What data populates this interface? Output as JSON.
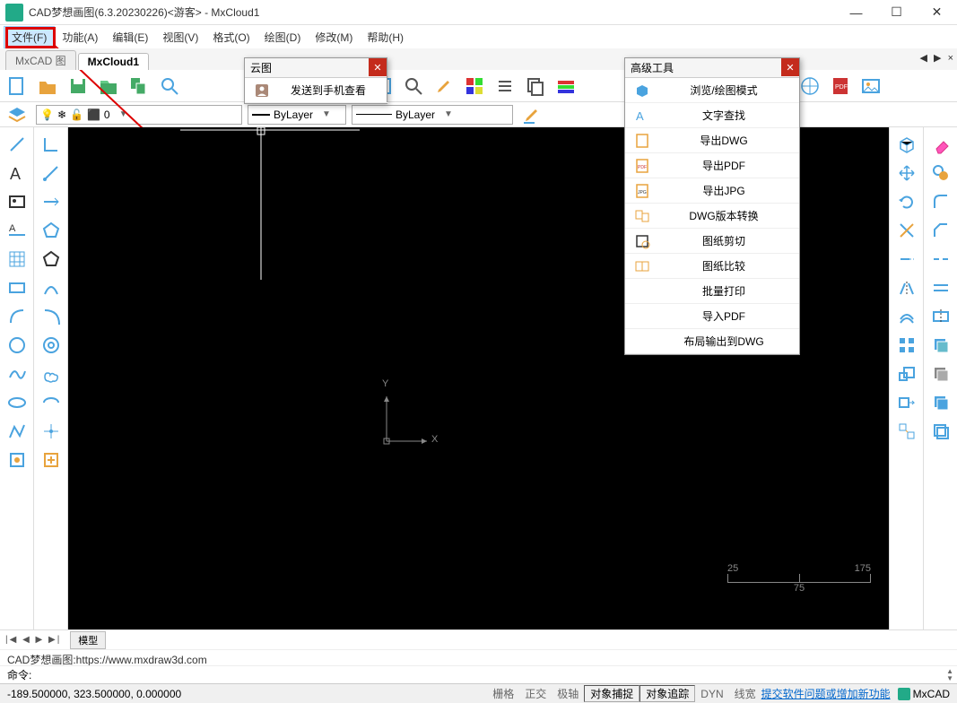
{
  "title": "CAD梦想画图(6.3.20230226)<游客> - MxCloud1",
  "menu": {
    "file": "文件(F)",
    "func": "功能(A)",
    "edit": "编辑(E)",
    "view": "视图(V)",
    "format": "格式(O)",
    "draw": "绘图(D)",
    "modify": "修改(M)",
    "help": "帮助(H)"
  },
  "tabs": {
    "t1": "MxCAD 图",
    "t2": "MxCloud1"
  },
  "cloudMenu": {
    "title": "云图",
    "item1": "发送到手机查看"
  },
  "advMenu": {
    "title": "高级工具",
    "i1": "浏览/绘图模式",
    "i2": "文字查找",
    "i3": "导出DWG",
    "i4": "导出PDF",
    "i5": "导出JPG",
    "i6": "DWG版本转换",
    "i7": "图纸剪切",
    "i8": "图纸比较",
    "i9": "批量打印",
    "i10": "导入PDF",
    "i11": "布局输出到DWG"
  },
  "prop": {
    "layer0": "0",
    "bylayer1": "ByLayer",
    "bylayer2": "ByLayer"
  },
  "scale": {
    "a": "25",
    "b": "75",
    "c": "175"
  },
  "bottomTab": "模型",
  "info": "CAD梦想画图:https://www.mxdraw3d.com",
  "cmd_label": "命令:",
  "coords": "-189.500000, 323.500000, 0.000000",
  "status": {
    "s1": "栅格",
    "s2": "正交",
    "s3": "极轴",
    "s4": "对象捕捉",
    "s5": "对象追踪",
    "s6": "DYN",
    "s7": "线宽",
    "link": "提交软件问题或增加新功能",
    "logo": "MxCAD"
  },
  "axis": {
    "x": "X",
    "y": "Y"
  }
}
